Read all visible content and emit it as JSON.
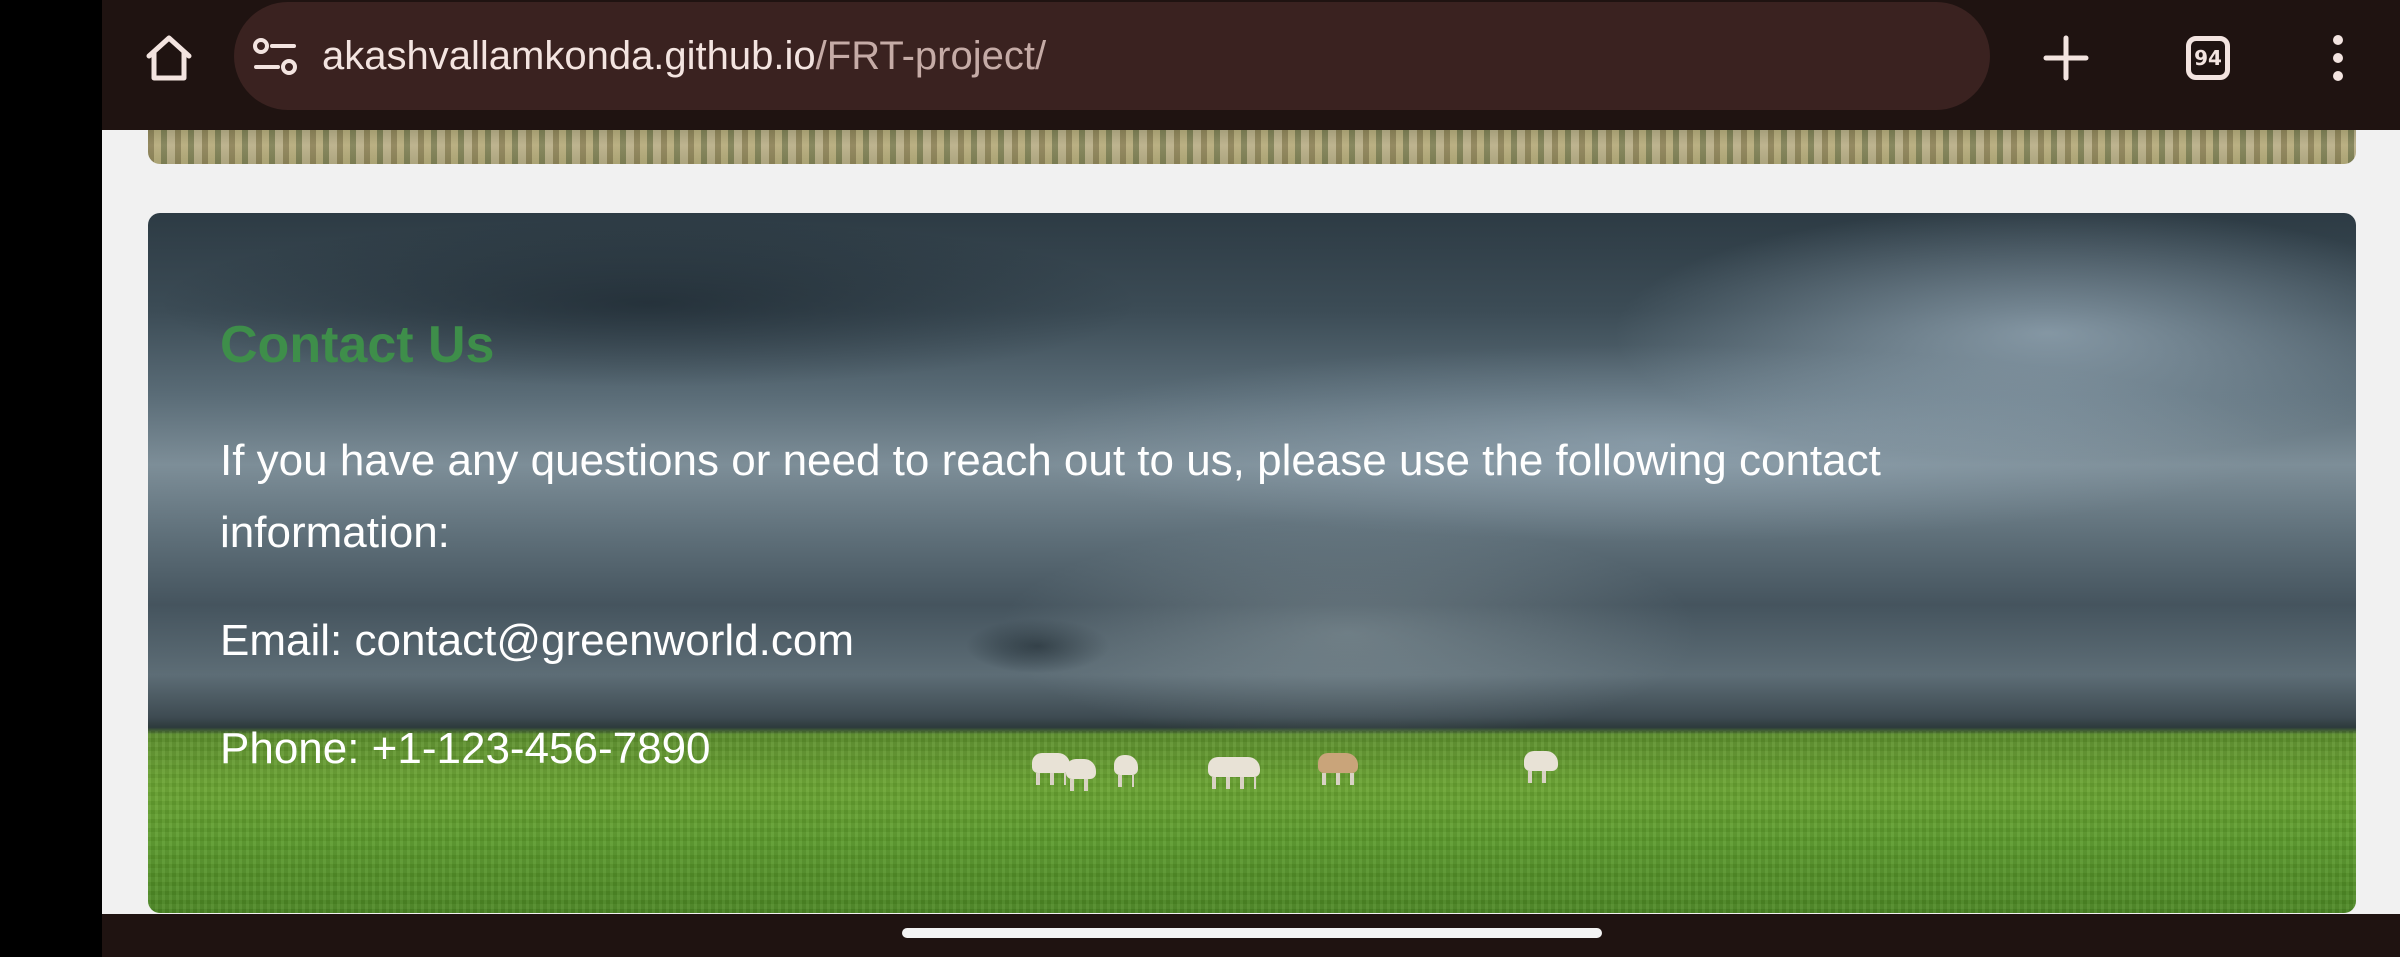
{
  "browser": {
    "url_host": "akashvallamkonda.github.io",
    "url_path": "/FRT-project/",
    "tab_count": "94",
    "icons": {
      "home": "home-icon",
      "site_info": "site-settings-icon",
      "new_tab": "plus-icon",
      "tabs": "tab-switcher-icon",
      "menu": "more-vert-icon"
    }
  },
  "contact": {
    "title": "Contact Us",
    "intro": "If you have any questions or need to reach out to us, please use the following contact information:",
    "email": "Email: contact@greenworld.com",
    "phone": "Phone: +1-123-456-7890"
  },
  "colors": {
    "toolbar_bg": "#1f1311",
    "url_bar_bg": "#3a2220",
    "title_green": "#3e8e4a",
    "page_bg": "#f1f1f1"
  }
}
